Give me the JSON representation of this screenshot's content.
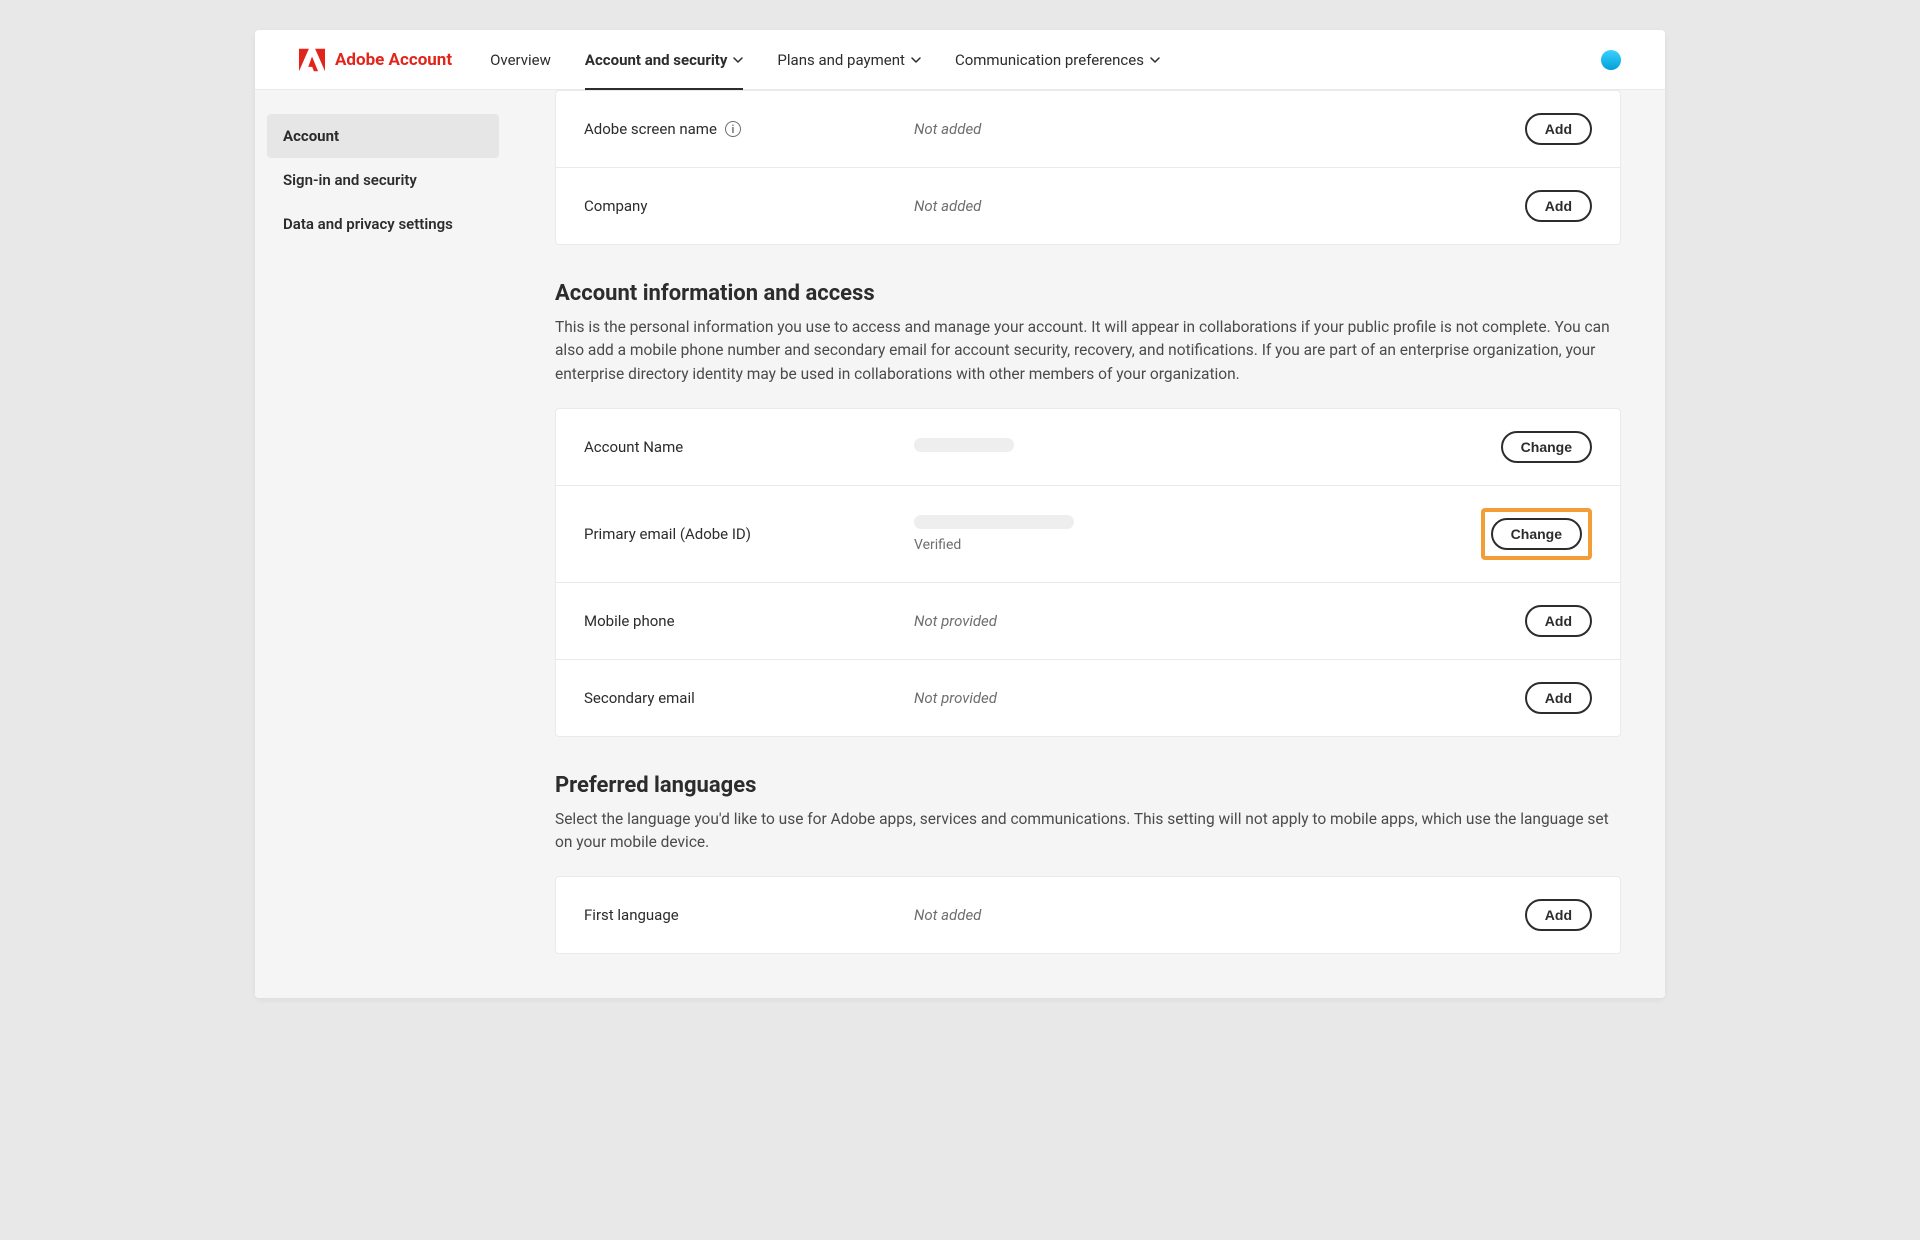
{
  "header": {
    "brand": "Adobe Account",
    "nav": [
      {
        "label": "Overview",
        "has_dropdown": false
      },
      {
        "label": "Account and security",
        "has_dropdown": true,
        "active": true
      },
      {
        "label": "Plans and payment",
        "has_dropdown": true
      },
      {
        "label": "Communication preferences",
        "has_dropdown": true
      }
    ]
  },
  "sidebar": {
    "items": [
      {
        "label": "Account",
        "active": true
      },
      {
        "label": "Sign-in and security"
      },
      {
        "label": "Data and privacy settings"
      }
    ]
  },
  "top_card": {
    "rows": [
      {
        "label": "Adobe screen name",
        "info_icon": true,
        "value": "Not added",
        "italic": true,
        "action": "Add"
      },
      {
        "label": "Company",
        "value": "Not added",
        "italic": true,
        "action": "Add"
      }
    ]
  },
  "section_account_info": {
    "title": "Account information and access",
    "description": "This is the personal information you use to access and manage your account. It will appear in collaborations if your public profile is not complete. You can also add a mobile phone number and secondary email for account security, recovery, and notifications. If you are part of an enterprise organization, your enterprise directory identity may be used in collaborations with other members of your organization.",
    "rows": [
      {
        "label": "Account Name",
        "value_redacted_width": "100px",
        "action": "Change"
      },
      {
        "label": "Primary email (Adobe ID)",
        "value_redacted_width": "160px",
        "sub": "Verified",
        "action": "Change",
        "highlighted": true
      },
      {
        "label": "Mobile phone",
        "value": "Not provided",
        "italic": true,
        "action": "Add"
      },
      {
        "label": "Secondary email",
        "value": "Not provided",
        "italic": true,
        "action": "Add"
      }
    ]
  },
  "section_languages": {
    "title": "Preferred languages",
    "description": "Select the language you'd like to use for Adobe apps, services and communications. This setting will not apply to mobile apps, which use the language set on your mobile device.",
    "rows": [
      {
        "label": "First language",
        "value": "Not added",
        "italic": true,
        "action": "Add"
      }
    ]
  }
}
